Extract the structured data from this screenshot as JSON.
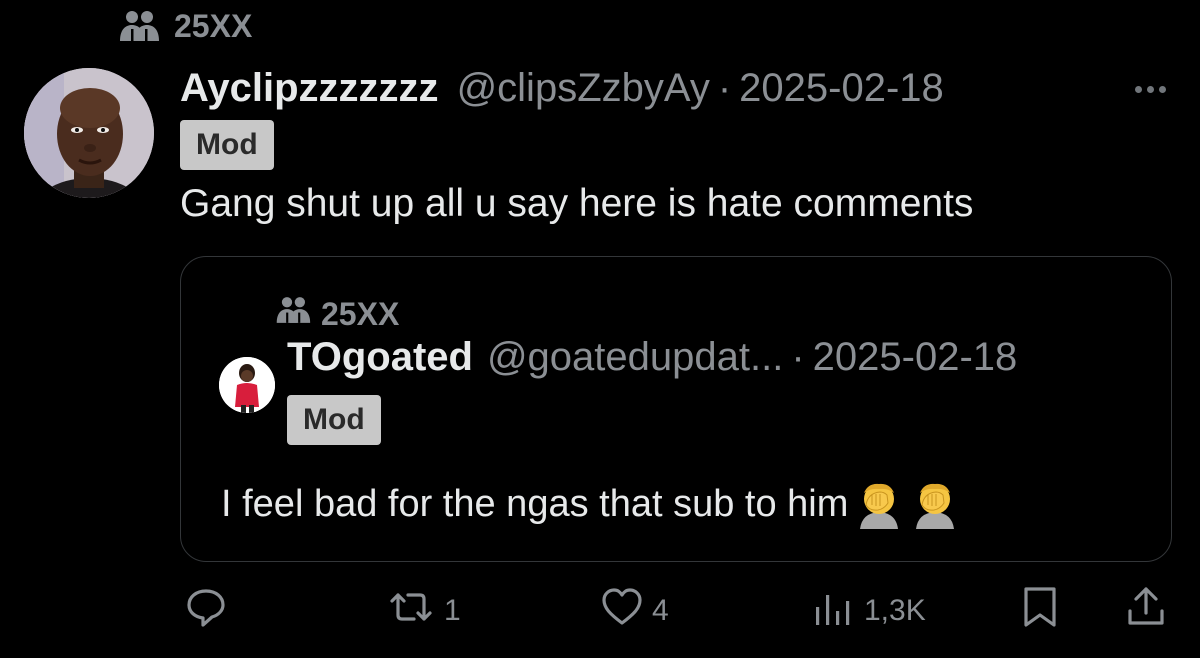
{
  "post": {
    "community": "25XX",
    "author": {
      "display_name": "Ayclipzzzzzzz",
      "handle": "@clipsZzbyAy",
      "separator": "·",
      "date": "2025-02-18",
      "badge": "Mod"
    },
    "text": "Gang shut up all u say here is hate comments",
    "more_icon": "more-horizontal-icon"
  },
  "quote": {
    "community": "25XX",
    "author": {
      "display_name": "TOgoated",
      "handle": "@goatedupdat...",
      "separator": "·",
      "date": "2025-02-18",
      "badge": "Mod"
    },
    "text": "I feel bad for the ngas that sub to him",
    "emojis": [
      "face-palm-emoji",
      "face-palm-emoji"
    ]
  },
  "actions": {
    "reply": {
      "icon": "reply-icon",
      "count": ""
    },
    "repost": {
      "icon": "repost-icon",
      "count": "1"
    },
    "like": {
      "icon": "heart-icon",
      "count": "4"
    },
    "views": {
      "icon": "views-icon",
      "count": "1,3K"
    },
    "bookmark": {
      "icon": "bookmark-icon"
    },
    "share": {
      "icon": "share-icon"
    }
  },
  "colors": {
    "background": "#000000",
    "primary_text": "#e7e9ea",
    "secondary_text": "#8b8f94",
    "badge_bg": "#c8c8c8",
    "card_border": "#333639"
  }
}
